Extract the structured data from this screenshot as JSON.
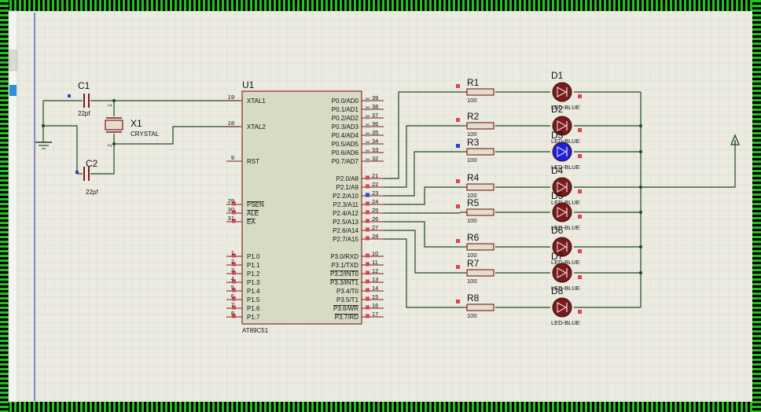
{
  "colors": {
    "border_green": "#22c21f",
    "canvas": "#ecebe1",
    "grid_minor": "#d6d5c9",
    "wire": "#1f4a1f",
    "chip_fill": "#d6dbc4",
    "chip_stroke": "#8a2a2a",
    "led_dark": "#7a1b1b",
    "led_on": "#2020d8",
    "resistor_fill": "#e3ddcb"
  },
  "components": {
    "c1": {
      "ref": "C1",
      "value": "22pf"
    },
    "c2": {
      "ref": "C2",
      "value": "22pf"
    },
    "x1": {
      "ref": "X1",
      "value": "CRYSTAL",
      "pin1": "1",
      "pin2": "2"
    },
    "u1": {
      "ref": "U1",
      "part": "AT89C51"
    }
  },
  "mcu_left_pins": [
    {
      "num": "19",
      "name": "XTAL1"
    },
    {
      "num": "18",
      "name": "XTAL2"
    },
    {
      "num": "9",
      "name": "RST"
    },
    {
      "num": "29",
      "name": "PSEN"
    },
    {
      "num": "30",
      "name": "ALE"
    },
    {
      "num": "31",
      "name": "EA"
    },
    {
      "num": "1",
      "name": "P1.0"
    },
    {
      "num": "2",
      "name": "P1.1"
    },
    {
      "num": "3",
      "name": "P1.2"
    },
    {
      "num": "4",
      "name": "P1.3"
    },
    {
      "num": "5",
      "name": "P1.4"
    },
    {
      "num": "6",
      "name": "P1.5"
    },
    {
      "num": "7",
      "name": "P1.6"
    },
    {
      "num": "8",
      "name": "P1.7"
    }
  ],
  "mcu_right_pins": [
    {
      "num": "39",
      "name": "P0.0/AD0"
    },
    {
      "num": "38",
      "name": "P0.1/AD1"
    },
    {
      "num": "37",
      "name": "P0.2/AD2"
    },
    {
      "num": "36",
      "name": "P0.3/AD3"
    },
    {
      "num": "35",
      "name": "P0.4/AD4"
    },
    {
      "num": "34",
      "name": "P0.5/AD5"
    },
    {
      "num": "33",
      "name": "P0.6/AD6"
    },
    {
      "num": "32",
      "name": "P0.7/AD7"
    },
    {
      "num": "21",
      "name": "P2.0/A8"
    },
    {
      "num": "22",
      "name": "P2.1/A9"
    },
    {
      "num": "23",
      "name": "P2.2/A10"
    },
    {
      "num": "24",
      "name": "P2.3/A11"
    },
    {
      "num": "25",
      "name": "P2.4/A12"
    },
    {
      "num": "26",
      "name": "P2.5/A13"
    },
    {
      "num": "27",
      "name": "P2.6/A14"
    },
    {
      "num": "28",
      "name": "P2.7/A15"
    },
    {
      "num": "10",
      "name": "P3.0/RXD"
    },
    {
      "num": "11",
      "name": "P3.1/TXD"
    },
    {
      "num": "12",
      "name": "P3.2/INT0"
    },
    {
      "num": "13",
      "name": "P3.3/INT1"
    },
    {
      "num": "14",
      "name": "P3.4/T0"
    },
    {
      "num": "15",
      "name": "P3.5/T1"
    },
    {
      "num": "16",
      "name": "P3.6/WR"
    },
    {
      "num": "17",
      "name": "P3.7/RD"
    }
  ],
  "resistors": [
    {
      "ref": "R1",
      "value": "100"
    },
    {
      "ref": "R2",
      "value": "100"
    },
    {
      "ref": "R3",
      "value": "100"
    },
    {
      "ref": "R4",
      "value": "100"
    },
    {
      "ref": "R5",
      "value": "100"
    },
    {
      "ref": "R6",
      "value": "100"
    },
    {
      "ref": "R7",
      "value": "100"
    },
    {
      "ref": "R8",
      "value": "100"
    }
  ],
  "leds": [
    {
      "ref": "D1",
      "part": "LED-BLUE",
      "lit": false
    },
    {
      "ref": "D2",
      "part": "LED-BLUE",
      "lit": false
    },
    {
      "ref": "D3",
      "part": "LED-BLUE",
      "lit": true
    },
    {
      "ref": "D4",
      "part": "LED-BLUE",
      "lit": false
    },
    {
      "ref": "D5",
      "part": "LED-BLUE",
      "lit": false
    },
    {
      "ref": "D6",
      "part": "LED-BLUE",
      "lit": false
    },
    {
      "ref": "D7",
      "part": "LED-BLUE",
      "lit": false
    },
    {
      "ref": "D8",
      "part": "LED-BLUE",
      "lit": false
    }
  ]
}
